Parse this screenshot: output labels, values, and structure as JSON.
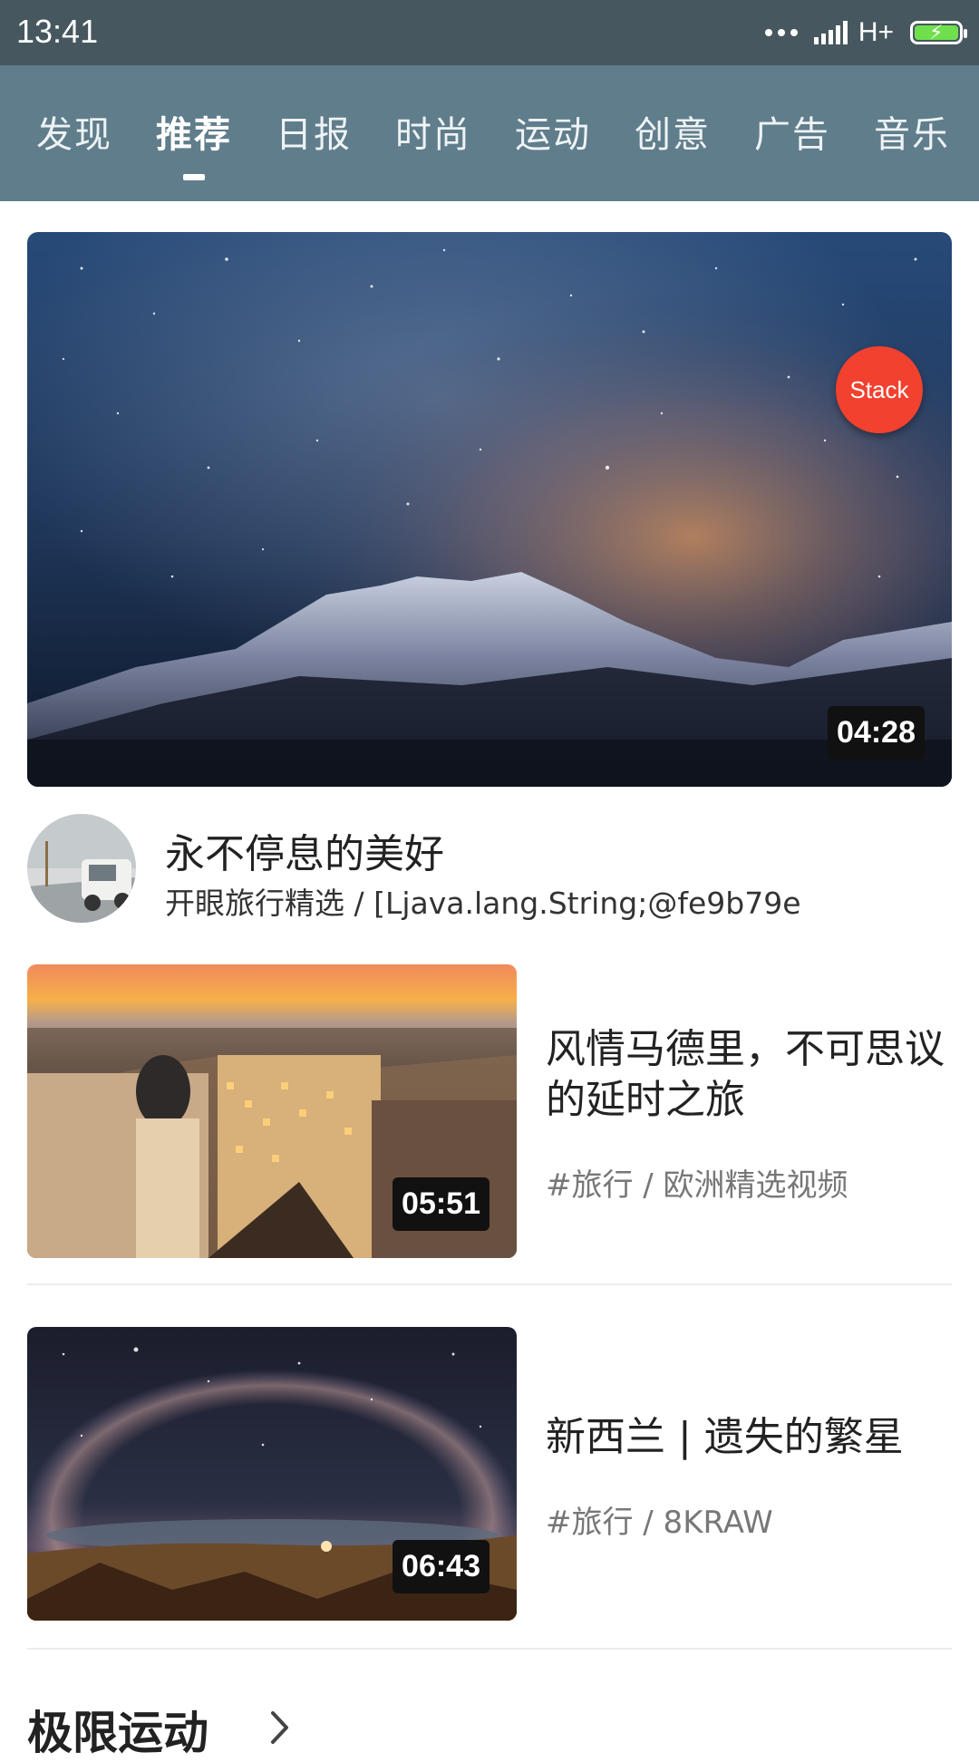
{
  "status_bar": {
    "time": "13:41",
    "network": "H+",
    "icons": [
      "more-dots-icon",
      "signal-icon",
      "battery-charging-icon"
    ]
  },
  "tabs": [
    {
      "label": "发现",
      "active": false
    },
    {
      "label": "推荐",
      "active": true
    },
    {
      "label": "日报",
      "active": false
    },
    {
      "label": "时尚",
      "active": false
    },
    {
      "label": "运动",
      "active": false
    },
    {
      "label": "创意",
      "active": false
    },
    {
      "label": "广告",
      "active": false
    },
    {
      "label": "音乐",
      "active": false
    }
  ],
  "featured": {
    "badge": "Stack",
    "duration": "04:28",
    "title": "永不停息的美好",
    "subtitle": "开眼旅行精选 / [Ljava.lang.String;@fe9b79e"
  },
  "videos": [
    {
      "title": "风情马德里，不可思议的延时之旅",
      "meta": "#旅行 / 欧洲精选视频",
      "duration": "05:51"
    },
    {
      "title": "新西兰 | 遗失的繁星",
      "meta": "#旅行 / 8KRAW",
      "duration": "06:43"
    }
  ],
  "section": {
    "title": "极限运动"
  },
  "colors": {
    "status_bar": "#46575f",
    "tab_bar": "#607d8b",
    "badge": "#f2412f"
  }
}
